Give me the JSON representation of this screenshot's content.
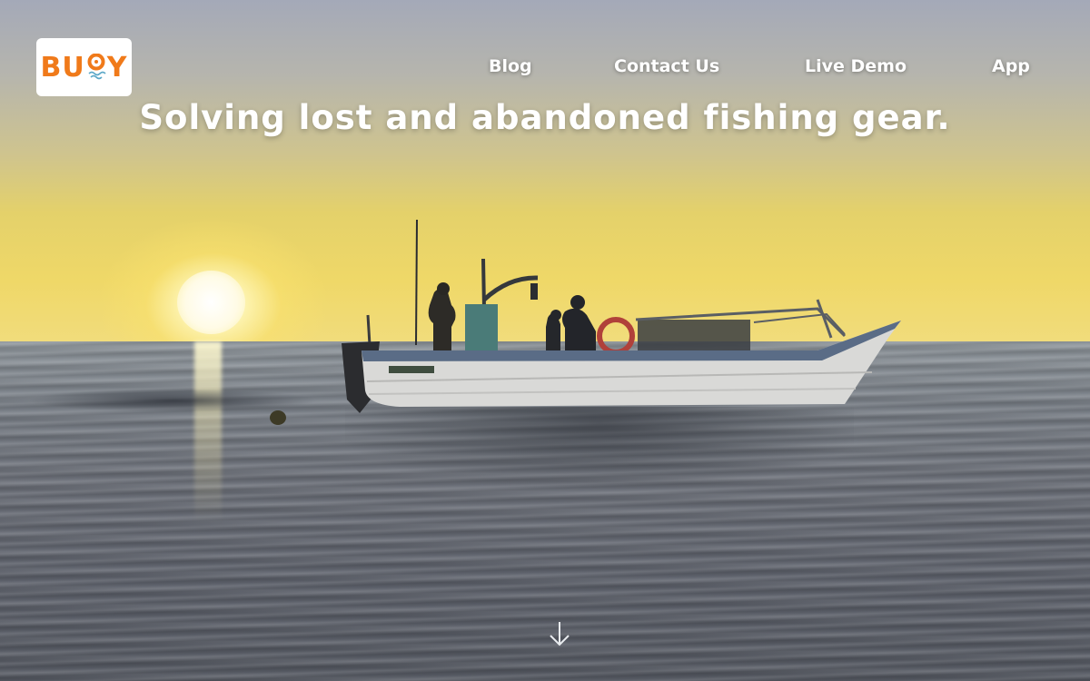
{
  "logo": {
    "text_left": "BU",
    "text_right": "Y",
    "icon": "buoy-icon"
  },
  "nav": {
    "items": [
      {
        "label": "Blog"
      },
      {
        "label": "Contact Us"
      },
      {
        "label": "Live Demo"
      },
      {
        "label": "App"
      }
    ]
  },
  "hero": {
    "headline": "Solving lost and abandoned fishing gear.",
    "scroll_icon": "arrow-down-icon"
  },
  "colors": {
    "brand": "#f07a1a",
    "nav_text": "#ffffff",
    "logo_bg": "#ffffff"
  }
}
